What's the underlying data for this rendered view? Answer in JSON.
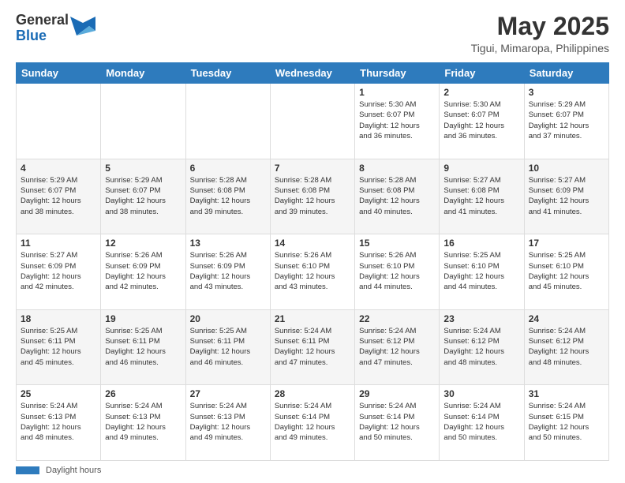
{
  "header": {
    "logo_general": "General",
    "logo_blue": "Blue",
    "title": "May 2025",
    "subtitle": "Tigui, Mimaropa, Philippines"
  },
  "days_of_week": [
    "Sunday",
    "Monday",
    "Tuesday",
    "Wednesday",
    "Thursday",
    "Friday",
    "Saturday"
  ],
  "footer": {
    "daylight_label": "Daylight hours"
  },
  "weeks": [
    {
      "days": [
        {
          "num": "",
          "info": ""
        },
        {
          "num": "",
          "info": ""
        },
        {
          "num": "",
          "info": ""
        },
        {
          "num": "",
          "info": ""
        },
        {
          "num": "1",
          "info": "Sunrise: 5:30 AM\nSunset: 6:07 PM\nDaylight: 12 hours\nand 36 minutes."
        },
        {
          "num": "2",
          "info": "Sunrise: 5:30 AM\nSunset: 6:07 PM\nDaylight: 12 hours\nand 36 minutes."
        },
        {
          "num": "3",
          "info": "Sunrise: 5:29 AM\nSunset: 6:07 PM\nDaylight: 12 hours\nand 37 minutes."
        }
      ]
    },
    {
      "days": [
        {
          "num": "4",
          "info": "Sunrise: 5:29 AM\nSunset: 6:07 PM\nDaylight: 12 hours\nand 38 minutes."
        },
        {
          "num": "5",
          "info": "Sunrise: 5:29 AM\nSunset: 6:07 PM\nDaylight: 12 hours\nand 38 minutes."
        },
        {
          "num": "6",
          "info": "Sunrise: 5:28 AM\nSunset: 6:08 PM\nDaylight: 12 hours\nand 39 minutes."
        },
        {
          "num": "7",
          "info": "Sunrise: 5:28 AM\nSunset: 6:08 PM\nDaylight: 12 hours\nand 39 minutes."
        },
        {
          "num": "8",
          "info": "Sunrise: 5:28 AM\nSunset: 6:08 PM\nDaylight: 12 hours\nand 40 minutes."
        },
        {
          "num": "9",
          "info": "Sunrise: 5:27 AM\nSunset: 6:08 PM\nDaylight: 12 hours\nand 41 minutes."
        },
        {
          "num": "10",
          "info": "Sunrise: 5:27 AM\nSunset: 6:09 PM\nDaylight: 12 hours\nand 41 minutes."
        }
      ]
    },
    {
      "days": [
        {
          "num": "11",
          "info": "Sunrise: 5:27 AM\nSunset: 6:09 PM\nDaylight: 12 hours\nand 42 minutes."
        },
        {
          "num": "12",
          "info": "Sunrise: 5:26 AM\nSunset: 6:09 PM\nDaylight: 12 hours\nand 42 minutes."
        },
        {
          "num": "13",
          "info": "Sunrise: 5:26 AM\nSunset: 6:09 PM\nDaylight: 12 hours\nand 43 minutes."
        },
        {
          "num": "14",
          "info": "Sunrise: 5:26 AM\nSunset: 6:10 PM\nDaylight: 12 hours\nand 43 minutes."
        },
        {
          "num": "15",
          "info": "Sunrise: 5:26 AM\nSunset: 6:10 PM\nDaylight: 12 hours\nand 44 minutes."
        },
        {
          "num": "16",
          "info": "Sunrise: 5:25 AM\nSunset: 6:10 PM\nDaylight: 12 hours\nand 44 minutes."
        },
        {
          "num": "17",
          "info": "Sunrise: 5:25 AM\nSunset: 6:10 PM\nDaylight: 12 hours\nand 45 minutes."
        }
      ]
    },
    {
      "days": [
        {
          "num": "18",
          "info": "Sunrise: 5:25 AM\nSunset: 6:11 PM\nDaylight: 12 hours\nand 45 minutes."
        },
        {
          "num": "19",
          "info": "Sunrise: 5:25 AM\nSunset: 6:11 PM\nDaylight: 12 hours\nand 46 minutes."
        },
        {
          "num": "20",
          "info": "Sunrise: 5:25 AM\nSunset: 6:11 PM\nDaylight: 12 hours\nand 46 minutes."
        },
        {
          "num": "21",
          "info": "Sunrise: 5:24 AM\nSunset: 6:11 PM\nDaylight: 12 hours\nand 47 minutes."
        },
        {
          "num": "22",
          "info": "Sunrise: 5:24 AM\nSunset: 6:12 PM\nDaylight: 12 hours\nand 47 minutes."
        },
        {
          "num": "23",
          "info": "Sunrise: 5:24 AM\nSunset: 6:12 PM\nDaylight: 12 hours\nand 48 minutes."
        },
        {
          "num": "24",
          "info": "Sunrise: 5:24 AM\nSunset: 6:12 PM\nDaylight: 12 hours\nand 48 minutes."
        }
      ]
    },
    {
      "days": [
        {
          "num": "25",
          "info": "Sunrise: 5:24 AM\nSunset: 6:13 PM\nDaylight: 12 hours\nand 48 minutes."
        },
        {
          "num": "26",
          "info": "Sunrise: 5:24 AM\nSunset: 6:13 PM\nDaylight: 12 hours\nand 49 minutes."
        },
        {
          "num": "27",
          "info": "Sunrise: 5:24 AM\nSunset: 6:13 PM\nDaylight: 12 hours\nand 49 minutes."
        },
        {
          "num": "28",
          "info": "Sunrise: 5:24 AM\nSunset: 6:14 PM\nDaylight: 12 hours\nand 49 minutes."
        },
        {
          "num": "29",
          "info": "Sunrise: 5:24 AM\nSunset: 6:14 PM\nDaylight: 12 hours\nand 50 minutes."
        },
        {
          "num": "30",
          "info": "Sunrise: 5:24 AM\nSunset: 6:14 PM\nDaylight: 12 hours\nand 50 minutes."
        },
        {
          "num": "31",
          "info": "Sunrise: 5:24 AM\nSunset: 6:15 PM\nDaylight: 12 hours\nand 50 minutes."
        }
      ]
    }
  ]
}
